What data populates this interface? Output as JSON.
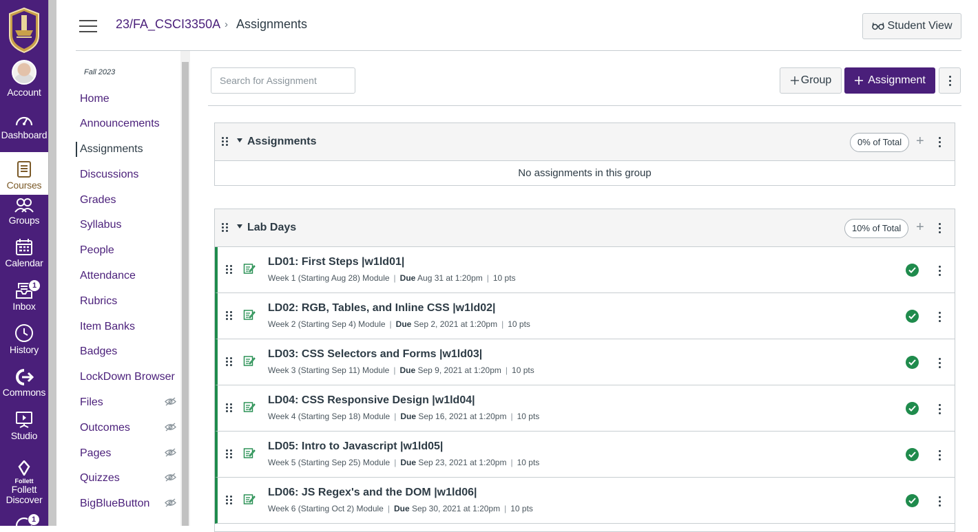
{
  "global_nav": {
    "items": [
      {
        "label": "Account",
        "icon": "avatar"
      },
      {
        "label": "Dashboard",
        "icon": "dashboard-icon"
      },
      {
        "label": "Courses",
        "icon": "courses-icon"
      },
      {
        "label": "Groups",
        "icon": "groups-icon"
      },
      {
        "label": "Calendar",
        "icon": "calendar-icon"
      },
      {
        "label": "Inbox",
        "icon": "inbox-icon",
        "badge": "1"
      },
      {
        "label": "History",
        "icon": "history-icon"
      },
      {
        "label": "Commons",
        "icon": "commons-icon"
      },
      {
        "label": "Studio",
        "icon": "studio-icon"
      },
      {
        "label": "Follett Discover",
        "icon": "follett-icon",
        "icon_text": "Follett"
      },
      {
        "badge": "1"
      }
    ],
    "active": "Courses"
  },
  "header": {
    "course": "23/FA_CSCI3350A",
    "separator": "›",
    "current": "Assignments",
    "student_view": "Student View"
  },
  "course_nav": {
    "term": "Fall 2023",
    "items": [
      {
        "label": "Home"
      },
      {
        "label": "Announcements"
      },
      {
        "label": "Assignments",
        "active": true
      },
      {
        "label": "Discussions"
      },
      {
        "label": "Grades"
      },
      {
        "label": "Syllabus"
      },
      {
        "label": "People"
      },
      {
        "label": "Attendance"
      },
      {
        "label": "Rubrics"
      },
      {
        "label": "Item Banks"
      },
      {
        "label": "Badges"
      },
      {
        "label": "LockDown Browser"
      },
      {
        "label": "Files",
        "hidden": true
      },
      {
        "label": "Outcomes",
        "hidden": true
      },
      {
        "label": "Pages",
        "hidden": true
      },
      {
        "label": "Quizzes",
        "hidden": true
      },
      {
        "label": "BigBlueButton",
        "hidden": true
      }
    ]
  },
  "toolbar": {
    "search_placeholder": "Search for Assignment",
    "group_label": "Group",
    "assignment_label": "Assignment"
  },
  "groups": [
    {
      "title": "Assignments",
      "weight": "0% of Total",
      "empty_message": "No assignments in this group",
      "assignments": []
    },
    {
      "title": "Lab Days",
      "weight": "10% of Total",
      "assignments": [
        {
          "title": "LD01: First Steps |w1ld01|",
          "module": "Week 1 (Starting Aug 28) Module",
          "due_label": "Due",
          "due": "Aug 31 at 1:20pm",
          "points": "10 pts",
          "published": true
        },
        {
          "title": "LD02: RGB, Tables, and Inline CSS |w1ld02|",
          "module": "Week 2 (Starting Sep 4) Module",
          "due_label": "Due",
          "due": "Sep 2, 2021 at 1:20pm",
          "points": "10 pts",
          "published": true
        },
        {
          "title": "LD03: CSS Selectors and Forms |w1ld03|",
          "module": "Week 3 (Starting Sep 11) Module",
          "due_label": "Due",
          "due": "Sep 9, 2021 at 1:20pm",
          "points": "10 pts",
          "published": true
        },
        {
          "title": "LD04: CSS Responsive Design |w1ld04|",
          "module": "Week 4 (Starting Sep 18) Module",
          "due_label": "Due",
          "due": "Sep 16, 2021 at 1:20pm",
          "points": "10 pts",
          "published": true
        },
        {
          "title": "LD05: Intro to Javascript |w1ld05|",
          "module": "Week 5 (Starting Sep 25) Module",
          "due_label": "Due",
          "due": "Sep 23, 2021 at 1:20pm",
          "points": "10 pts",
          "published": true
        },
        {
          "title": "LD06: JS Regex's and the DOM |w1ld06|",
          "module": "Week 6 (Starting Oct 2) Module",
          "due_label": "Due",
          "due": "Sep 30, 2021 at 1:20pm",
          "points": "10 pts",
          "published": true
        }
      ]
    }
  ],
  "colors": {
    "brand": "#4a1f7a",
    "success": "#1f8b4c",
    "link": "#4a1f7a"
  }
}
